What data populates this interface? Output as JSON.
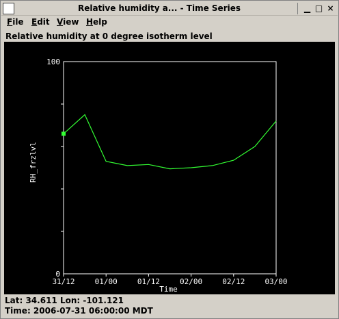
{
  "window": {
    "title": "Relative humidity a... - Time Series"
  },
  "menu": {
    "items": [
      {
        "label_first": "F",
        "label_rest": "ile"
      },
      {
        "label_first": "E",
        "label_rest": "dit"
      },
      {
        "label_first": "V",
        "label_rest": "iew"
      },
      {
        "label_first": "H",
        "label_rest": "elp"
      }
    ]
  },
  "plot_title": "Relative humidity at 0 degree isotherm level",
  "status": {
    "location": "Lat: 34.611 Lon: -101.121",
    "time": "Time: 2006-07-31 06:00:00 MDT"
  },
  "colors": {
    "background": "#000000",
    "axis": "#ffffff",
    "line": "#33ff33"
  },
  "chart_data": {
    "type": "line",
    "xlabel": "Time",
    "ylabel": "RH_frzlvl",
    "ylim": [
      0,
      100
    ],
    "y_ticks": [
      "0",
      "100"
    ],
    "x_ticks": [
      "31/12",
      "01/00",
      "01/12",
      "02/00",
      "02/12",
      "03/00"
    ],
    "x_tick_hours": [
      0,
      12,
      24,
      36,
      48,
      60
    ],
    "series": [
      {
        "x_hours": [
          0,
          6,
          12,
          18,
          24,
          30,
          36,
          42,
          48,
          54,
          60
        ],
        "values": [
          66,
          75,
          53,
          51,
          51.5,
          49.5,
          50,
          51,
          53.5,
          60,
          72
        ]
      }
    ],
    "marker": {
      "x_hours": 0,
      "value": 66
    }
  }
}
